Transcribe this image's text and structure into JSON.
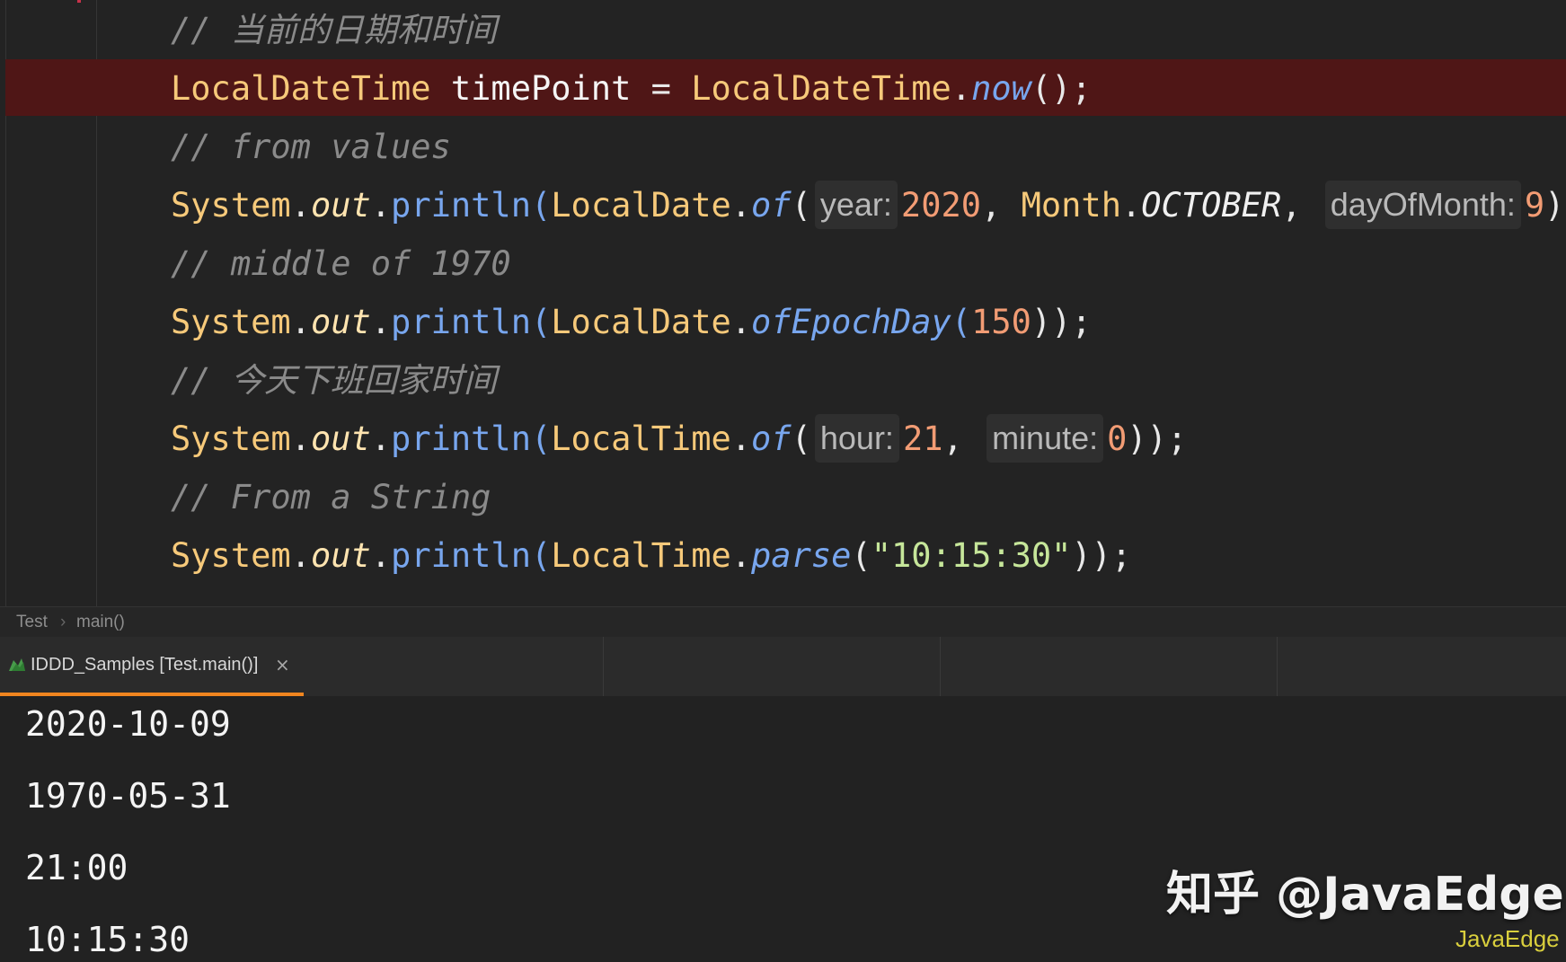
{
  "editor": {
    "lines": {
      "c1": {
        "text": "// 当前的日期和时间"
      },
      "l1": {
        "cls1": "LocalDateTime",
        "var": "timePoint",
        "eq": "=",
        "cls2": "LocalDateTime",
        "dot": ".",
        "method": "now",
        "tail": "();"
      },
      "c2": {
        "text": "// from values"
      },
      "l2": {
        "sys": "System",
        "dot1": ".",
        "out": "out",
        "dot2": ".",
        "println": "println",
        "open": "(",
        "cls": "LocalDate",
        "dot3": ".",
        "method": "of",
        "paren": "(",
        "hint1": "year:",
        "num1": "2020",
        "comma1": ",",
        "cls2": "Month",
        "dot4": ".",
        "field": "OCTOBER",
        "comma2": ",",
        "hint2": "dayOfMonth:",
        "num2": "9",
        "tail": "));"
      },
      "c3": {
        "text": "// middle of 1970"
      },
      "l3": {
        "sys": "System",
        "dot1": ".",
        "out": "out",
        "dot2": ".",
        "println": "println",
        "open": "(",
        "cls": "LocalDate",
        "dot3": ".",
        "method": "ofEpochDay",
        "paren": "(",
        "num": "150",
        "tail": "));"
      },
      "c4": {
        "text": "// 今天下班回家时间"
      },
      "l4": {
        "sys": "System",
        "dot1": ".",
        "out": "out",
        "dot2": ".",
        "println": "println",
        "open": "(",
        "cls": "LocalTime",
        "dot3": ".",
        "method": "of",
        "paren": "(",
        "hint1": "hour:",
        "num1": "21",
        "comma": ",",
        "hint2": "minute:",
        "num2": "0",
        "tail": "));"
      },
      "c5": {
        "text": "// From a String"
      },
      "l5": {
        "sys": "System",
        "dot1": ".",
        "out": "out",
        "dot2": ".",
        "println": "println",
        "open": "(",
        "cls": "LocalTime",
        "dot3": ".",
        "method": "parse",
        "paren": "(",
        "str": "\"10:15:30\"",
        "tail": "));"
      }
    }
  },
  "breadcrumb": {
    "items": [
      "Test",
      "main()"
    ],
    "separator": "›"
  },
  "run_tab": {
    "icon": "run-config-icon",
    "label": "IDDD_Samples [Test.main()]",
    "close": "×"
  },
  "console": {
    "lines": [
      "2020-10-09",
      "1970-05-31",
      "21:00",
      "10:15:30"
    ]
  },
  "watermark": {
    "main": "知乎 @JavaEdge",
    "sub": "JavaEdge"
  },
  "colors": {
    "accent": "#f0851f",
    "highlight_line": "#4f1616",
    "class": "#f6c97a",
    "method": "#78a6ee",
    "number": "#f29c74",
    "string": "#c6e69a",
    "comment": "#8a8a8a"
  }
}
